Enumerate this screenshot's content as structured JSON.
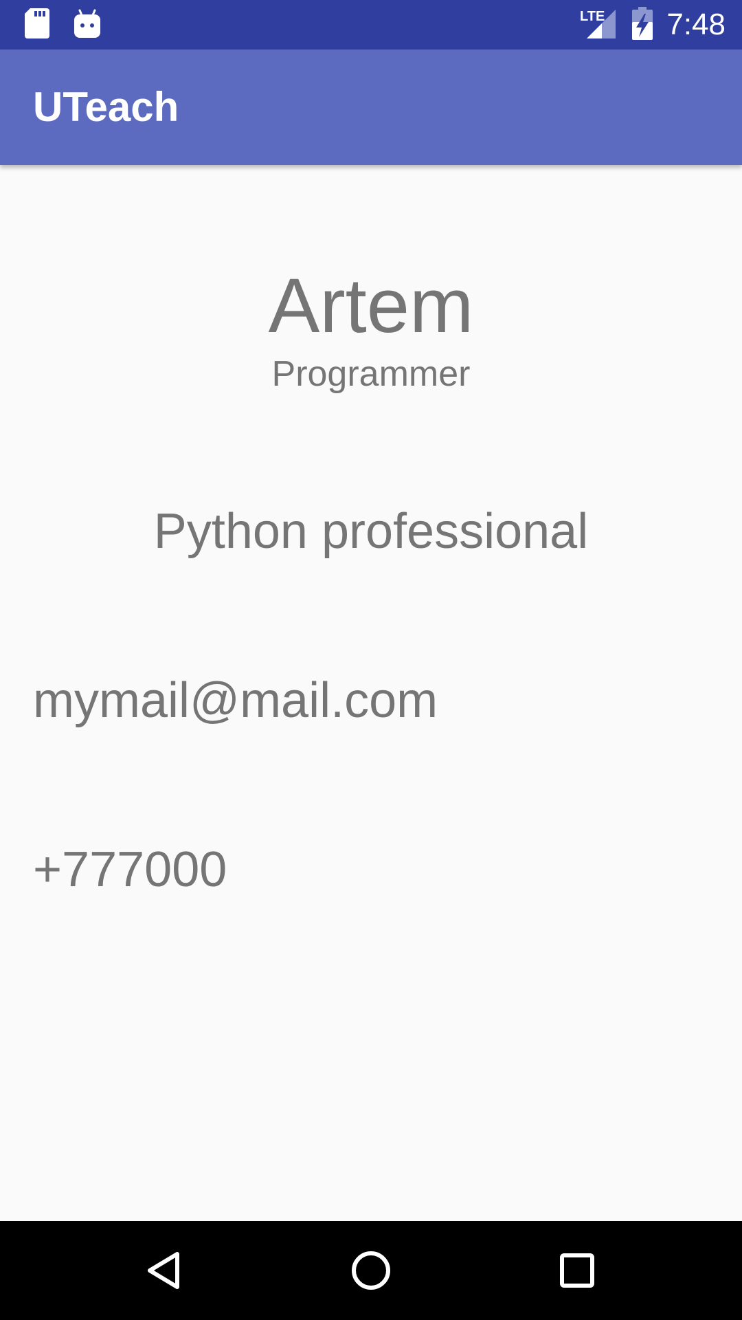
{
  "status_bar": {
    "time": "7:48",
    "network_label": "LTE",
    "icons": [
      "sd-card-icon",
      "android-icon",
      "signal-icon",
      "battery-charging-icon"
    ],
    "color": "#303f9f"
  },
  "app_bar": {
    "title": "UTeach",
    "color": "#5c6bc0"
  },
  "profile": {
    "name": "Artem",
    "role": "Programmer",
    "skill": "Python professional",
    "email": "mymail@mail.com",
    "phone": "+777000",
    "text_color": "#757575"
  },
  "nav_bar": {
    "icons": [
      "back-icon",
      "home-icon",
      "recents-icon"
    ]
  }
}
